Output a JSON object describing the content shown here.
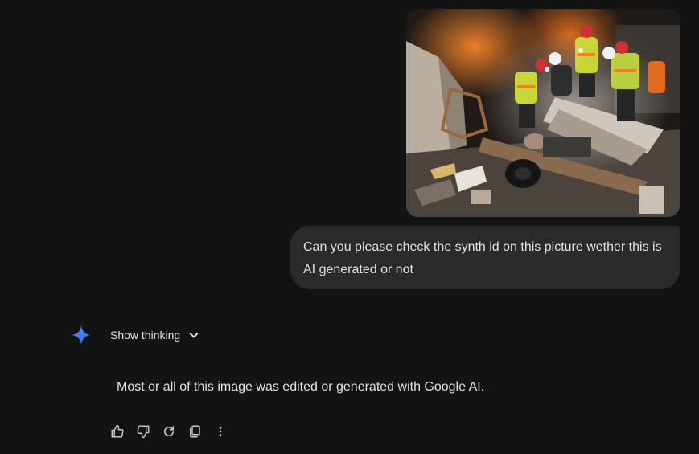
{
  "conversation": {
    "user_message": {
      "image_alt": "Rescue workers with headlamps searching rubble of a collapsed building at night",
      "text": "Can you please check the synth id on this picture wether this is AI generated or not"
    },
    "model_response": {
      "avatar_icon": "gemini-sparkle-icon",
      "show_thinking_label": "Show thinking",
      "text": "Most or all of this image was edited or generated with Google AI."
    },
    "actions": [
      {
        "name": "thumbs-up-icon"
      },
      {
        "name": "thumbs-down-icon"
      },
      {
        "name": "regenerate-icon"
      },
      {
        "name": "copy-icon"
      },
      {
        "name": "more-options-icon"
      }
    ]
  },
  "colors": {
    "background": "#131314",
    "bubble": "#282a2c",
    "text": "#e3e3e3",
    "accent": "#4a86f7"
  }
}
